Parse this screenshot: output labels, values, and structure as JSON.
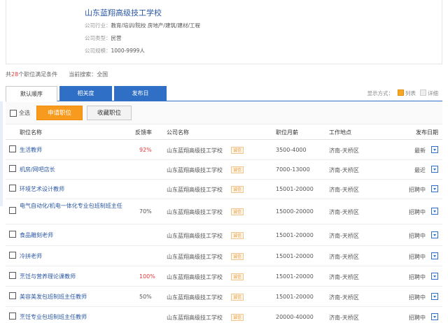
{
  "company": {
    "name": "山东蓝翔高级技工学校",
    "industry_label": "公司行业：",
    "industry_value": "教育/培训/院校 房地产/建筑/建材/工程",
    "type_label": "公司类型：",
    "type_value": "民营",
    "size_label": "公司规模：",
    "size_value": "1000-9999人"
  },
  "summary": {
    "prefix": "共",
    "count": "28",
    "suffix": "个职位满足条件",
    "search_label": "当前搜索：",
    "search_value": "全国"
  },
  "tabs": [
    {
      "label": "默认顺序",
      "active": true
    },
    {
      "label": "相关度",
      "active": false
    },
    {
      "label": "发布日",
      "active": false
    }
  ],
  "display_mode": {
    "label": "显示方式：",
    "list": "列表",
    "detail": "详细"
  },
  "toolbar": {
    "select_all": "全选",
    "apply": "申请职位",
    "save": "收藏职位"
  },
  "columns": {
    "title": "职位名称",
    "rate": "反馈率",
    "company": "公司名称",
    "salary": "职位月薪",
    "location": "工作地点",
    "date": "发布日期"
  },
  "badge_text": "诚信",
  "rows": [
    {
      "title": "生活教师",
      "rate": "92%",
      "company": "山东蓝翔高级技工学校",
      "salary": "3500-4000",
      "location": "济南-天桥区",
      "status": "最新"
    },
    {
      "title": "机房/网吧店长",
      "rate": "",
      "company": "山东蓝翔高级技工学校",
      "salary": "7000-13000",
      "location": "济南-天桥区",
      "status": "最近"
    },
    {
      "title": "环境艺术设计教师",
      "rate": "",
      "company": "山东蓝翔高级技工学校",
      "salary": "15001-20000",
      "location": "济南-天桥区",
      "status": "招聘中"
    },
    {
      "title": "电气自动化/机电一体化专业包班制班主任",
      "rate": "70%",
      "company": "山东蓝翔高级技工学校",
      "salary": "15000-20000",
      "location": "济南-天桥区",
      "status": "招聘中"
    },
    {
      "title": "食品雕刻老师",
      "rate": "",
      "company": "山东蓝翔高级技工学校",
      "salary": "15001-20000",
      "location": "济南-天桥区",
      "status": "招聘中"
    },
    {
      "title": "冷拼老师",
      "rate": "",
      "company": "山东蓝翔高级技工学校",
      "salary": "15001-20000",
      "location": "济南-天桥区",
      "status": "招聘中"
    },
    {
      "title": "烹饪与营养理论课教师",
      "rate": "100%",
      "company": "山东蓝翔高级技工学校",
      "salary": "15001-20000",
      "location": "济南-天桥区",
      "status": "招聘中"
    },
    {
      "title": "美容美发包班制班主任教师",
      "rate": "50%",
      "company": "山东蓝翔高级技工学校",
      "salary": "15001-20000",
      "location": "济南-天桥区",
      "status": "招聘中"
    },
    {
      "title": "烹饪专业包班制班主任教师",
      "rate": "",
      "company": "山东蓝翔高级技工学校",
      "salary": "20000-40000",
      "location": "济南-天桥区",
      "status": "招聘中"
    }
  ]
}
